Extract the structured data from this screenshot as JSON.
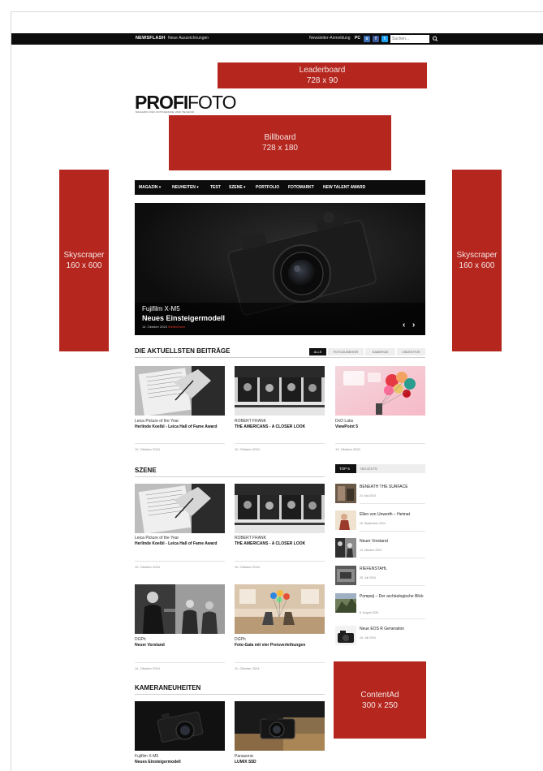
{
  "topbar": {
    "newsflash_label": "NEWSFLASH",
    "newsflash_text": "Neue Auszeichnungen",
    "newsletter_label": "Newsletter-Anmeldung",
    "pc_label": "PC",
    "social": [
      "o",
      "f",
      "t"
    ],
    "search_placeholder": "Suchen..."
  },
  "ads": {
    "leaderboard": {
      "name": "Leaderboard",
      "size": "728 x 90"
    },
    "billboard": {
      "name": "Billboard",
      "size": "728 x 180"
    },
    "skyscraper_left": {
      "name": "Skyscraper",
      "size": "160 x 600"
    },
    "skyscraper_right": {
      "name": "Skyscraper",
      "size": "160 x 600"
    },
    "contentad": {
      "name": "ContentAd",
      "size": "300 x 250"
    }
  },
  "logo": {
    "bold": "PROFI",
    "light": "FOTO",
    "tagline": "MAGAZIN FÜR FOTOGRAFIE UND TECHNIK"
  },
  "nav": {
    "items": [
      "MAGAZIN ▾",
      "NEUHEITEN ▾",
      "TEST",
      "SZENE ▾",
      "PORTFOLIO",
      "FOTOMARKT",
      "NEW TALENT AWARD"
    ]
  },
  "hero": {
    "kicker": "Fujifilm X-M5",
    "title": "Neues Einsteigermodell",
    "date": "14. Oktober 2024",
    "more": "Weiterlesen",
    "prev": "‹",
    "next": "›"
  },
  "latest": {
    "title": "DIE AKTUELLSTEN BEITRÄGE",
    "filters": [
      "ALLE",
      "FOTOZUBEHÖR",
      "KAMERAS",
      "OBJEKTIVE"
    ],
    "cards": [
      {
        "kicker": "Leica Picture of the Year",
        "title": "Herlinde Koelbl - Leica Hall of Fame Award",
        "date": "10. Oktober 2024"
      },
      {
        "kicker": "ROBERT FRANK",
        "title": "THE AMERICANS - A CLOSER LOOK",
        "date": "10. Oktober 2024"
      },
      {
        "kicker": "DxO Labs",
        "title": "ViewPoint 5",
        "date": "10. Oktober 2024"
      }
    ]
  },
  "szene": {
    "title": "SZENE",
    "cards": [
      {
        "kicker": "Leica Picture of the Year",
        "title": "Herlinde Koelbl - Leica Hall of Fame Award",
        "date": "10. Oktober 2024"
      },
      {
        "kicker": "ROBERT FRANK",
        "title": "THE AMERICANS - A CLOSER LOOK",
        "date": "10. Oktober 2024"
      },
      {
        "kicker": "DGPh",
        "title": "Neuer Vorstand",
        "date": "14. Oktober 2024"
      },
      {
        "kicker": "DGPh",
        "title": "Foto-Gala mit vier Preisverleihungen",
        "date": "11. Oktober 2024"
      }
    ]
  },
  "sidebar": {
    "tabs": [
      "TOP 5",
      "NEUESTE"
    ],
    "items": [
      {
        "title": "BENEATH THE SURFACE",
        "date": "24. Mai 2024"
      },
      {
        "title": "Ellen von Unwerth – Heimat",
        "date": "16. September 2024"
      },
      {
        "title": "Neuer Vorstand",
        "date": "14. Oktober 2024"
      },
      {
        "title": "RIEFENSTAHL",
        "date": "28. Juli 2024"
      },
      {
        "title": "Pompeji – Der archäologische Blick",
        "date": "8. August 2024"
      },
      {
        "title": "Neue EOS R Generation",
        "date": "18. Juli 2024"
      }
    ]
  },
  "kamera": {
    "title": "KAMERANEUHEITEN",
    "cards": [
      {
        "kicker": "Fujifilm X-M5",
        "title": "Neues Einsteigermodell"
      },
      {
        "kicker": "Panasonic",
        "title": "LUMIX S5D"
      }
    ]
  },
  "colors": {
    "accent": "#b5261e",
    "bar": "#0c0c0c",
    "link_red": "#e0352b"
  }
}
